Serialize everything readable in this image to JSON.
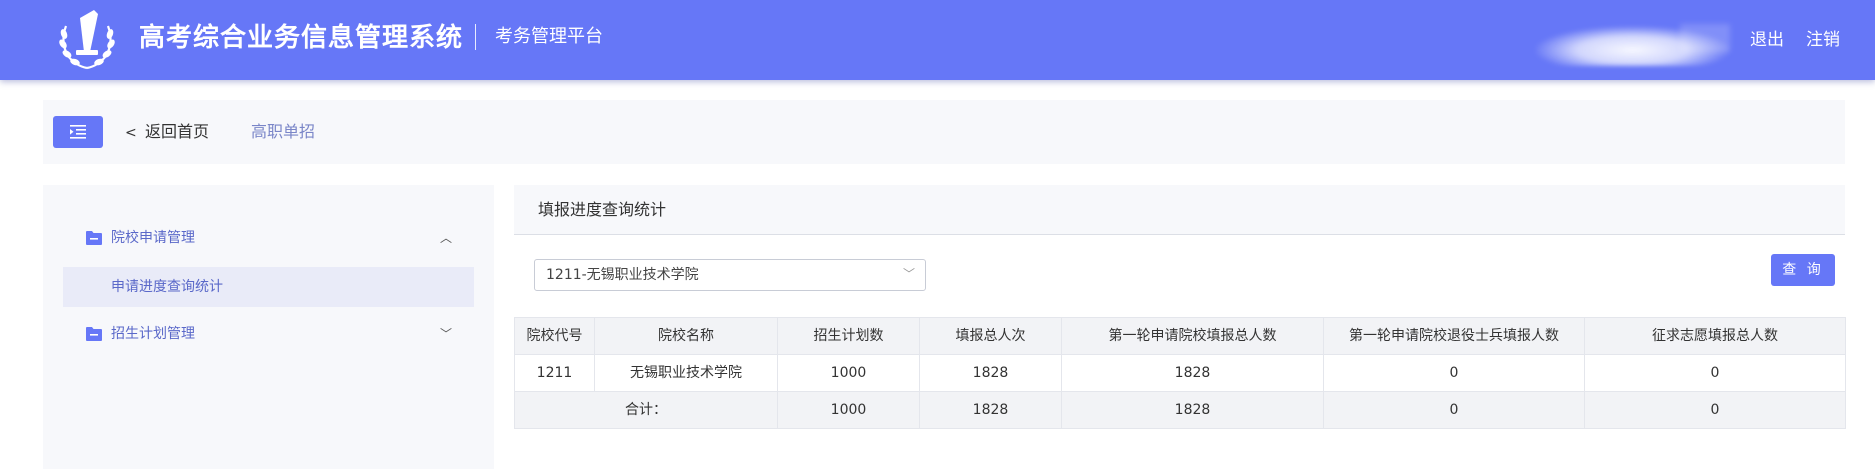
{
  "header": {
    "title": "高考综合业务信息管理系统",
    "subtitle": "考务管理平台",
    "logout_label": "退出",
    "cancel_label": "注销",
    "logo_icon": "emblem-logo-icon",
    "bg_color": "#6677f7"
  },
  "breadcrumb": {
    "menu_icon": "menu-indent-icon",
    "back_label": "返回首页",
    "current_label": "高职单招"
  },
  "sidebar": {
    "items": [
      {
        "label": "院校申请管理",
        "icon": "folder-icon",
        "expanded": true,
        "children": [
          {
            "label": "申请进度查询统计",
            "active": true
          }
        ]
      },
      {
        "label": "招生计划管理",
        "icon": "folder-icon",
        "expanded": false
      }
    ]
  },
  "main": {
    "title": "填报进度查询统计",
    "school_select": {
      "value": "1211-无锡职业技术学院"
    },
    "query_label": "查 询",
    "table": {
      "headers": [
        "院校代号",
        "院校名称",
        "招生计划数",
        "填报总人次",
        "第一轮申请院校填报总人数",
        "第一轮申请院校退役士兵填报人数",
        "征求志愿填报总人数"
      ],
      "rows": [
        [
          "1211",
          "无锡职业技术学院",
          "1000",
          "1828",
          "1828",
          "0",
          "0"
        ]
      ],
      "total": {
        "label": "合计：",
        "values": [
          "1000",
          "1828",
          "1828",
          "0",
          "0"
        ]
      }
    }
  }
}
